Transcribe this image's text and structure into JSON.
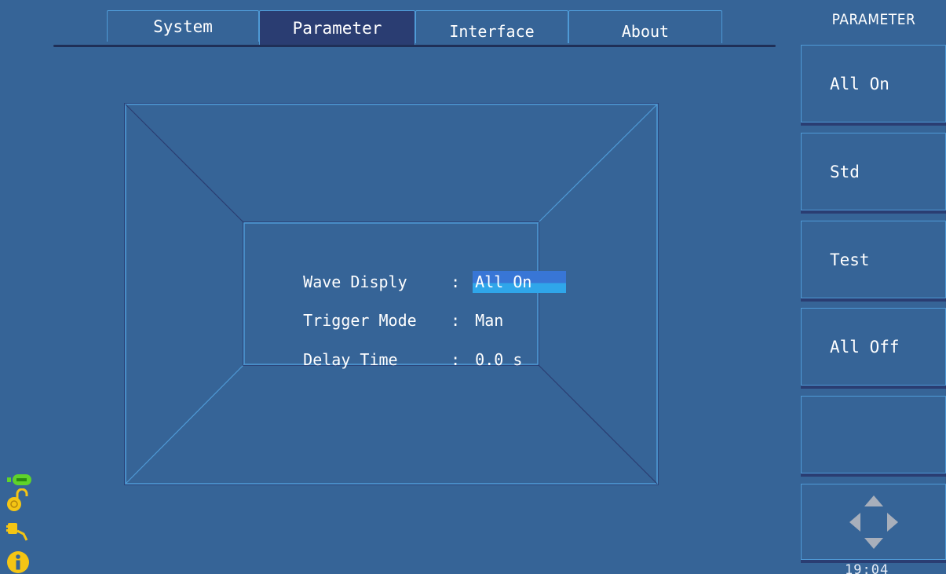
{
  "tabs": [
    {
      "label": "System",
      "active": false
    },
    {
      "label": "Parameter",
      "active": true
    },
    {
      "label": "Interface",
      "active": false
    },
    {
      "label": "About",
      "active": false
    }
  ],
  "panel": {
    "title": "PARAMETER",
    "softkeys": [
      {
        "label": "All On"
      },
      {
        "label": "Std"
      },
      {
        "label": "Test"
      },
      {
        "label": "All Off"
      },
      {
        "label": ""
      }
    ],
    "nav_icon": "direction-pad-icon"
  },
  "parameters": [
    {
      "label": "Wave Disply",
      "value": "All On",
      "selected": true
    },
    {
      "label": "Trigger Mode",
      "value": "Man",
      "selected": false
    },
    {
      "label": "Delay Time",
      "value": "0.0 s",
      "selected": false
    }
  ],
  "status_icons": [
    "usb-icon",
    "unlock-icon",
    "power-plug-icon",
    "info-icon"
  ],
  "clock": "19:04",
  "colors": {
    "background": "#366497",
    "active_tab": "#2a3d72",
    "border": "#4f9ad6",
    "selection": "#3876d6",
    "usb_green": "#5fd32a",
    "icon_yellow": "#f4c514"
  }
}
